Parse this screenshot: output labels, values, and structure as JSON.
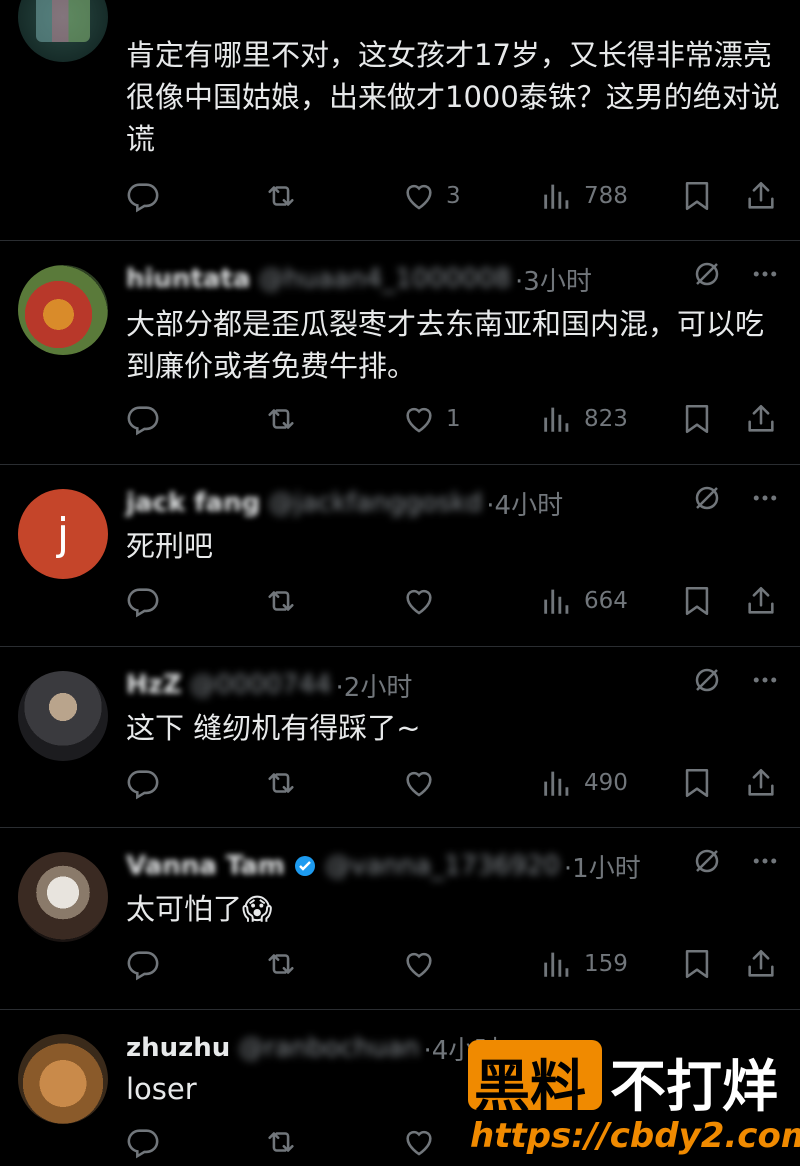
{
  "posts": [
    {
      "text": "肯定有哪里不对，这女孩才17岁，又长得非常漂亮很像中国姑娘，出来做才1000泰铢？这男的绝对说谎",
      "likes": "3",
      "views": "788"
    },
    {
      "name": "hiuntata",
      "handle": "@huaan4_1000008",
      "time": "·3小时",
      "text": "大部分都是歪瓜裂枣才去东南亚和国内混，可以吃到廉价或者免费牛排。",
      "likes": "1",
      "views": "823"
    },
    {
      "name": "jack fang",
      "handle": "@jackfanggoskd",
      "time": "·4小时",
      "avatar_letter": "j",
      "text": "死刑吧",
      "likes": "",
      "views": "664"
    },
    {
      "name": "HzZ",
      "handle": "@0000744",
      "time": "·2小时",
      "text": "这下 缝纫机有得踩了~",
      "likes": "",
      "views": "490"
    },
    {
      "name": "Vanna Tam",
      "handle": "@vanna_1736920",
      "time": "·1小时",
      "text": "太可怕了😱",
      "likes": "",
      "views": "159"
    },
    {
      "name": "zhuzhu",
      "handle": "@ranbochuan",
      "time": "·4小时",
      "text": "loser",
      "likes": "",
      "views": ""
    }
  ],
  "watermark": {
    "part1": "黑料",
    "part2": "不打烊",
    "url": "https://cbdy2.com"
  },
  "colors": {
    "background": "#000000",
    "text": "#e7e9ea",
    "muted": "#71767b",
    "brand": "#f08a00"
  }
}
